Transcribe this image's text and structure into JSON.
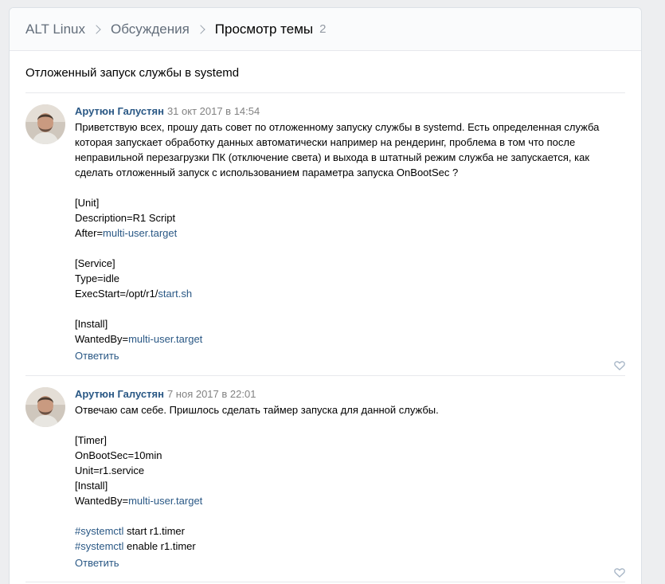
{
  "breadcrumb": {
    "community": "ALT Linux",
    "section": "Обсуждения",
    "current": "Просмотр темы",
    "count": "2"
  },
  "topic": {
    "title": "Отложенный запуск службы в systemd"
  },
  "posts": [
    {
      "author": "Арутюн Галустян",
      "date": "31 окт 2017 в 14:54",
      "reply_label": "Ответить",
      "lines": [
        [
          {
            "t": "Приветствую всех, прошу дать совет по отложенному запуску службы в systemd. Есть определенная служба"
          }
        ],
        [
          {
            "t": "которая запускает обработку данных автоматически например на рендеринг, проблема в том что после"
          }
        ],
        [
          {
            "t": "неправильной перезагрузки ПК (отключение света) и выхода в штатный режим служба не запускается, как"
          }
        ],
        [
          {
            "t": "сделать отложенный запуск с использованием параметра запуска OnBootSec ?"
          }
        ],
        [
          {
            "t": ""
          }
        ],
        [
          {
            "t": "[Unit]"
          }
        ],
        [
          {
            "t": "Description=R1 Script"
          }
        ],
        [
          {
            "t": "After="
          },
          {
            "t": "multi-user.target",
            "link": true
          }
        ],
        [
          {
            "t": ""
          }
        ],
        [
          {
            "t": "[Service]"
          }
        ],
        [
          {
            "t": "Type=idle"
          }
        ],
        [
          {
            "t": "ExecStart=/opt/r1/"
          },
          {
            "t": "start.sh",
            "link": true
          }
        ],
        [
          {
            "t": ""
          }
        ],
        [
          {
            "t": "[Install]"
          }
        ],
        [
          {
            "t": "WantedBy="
          },
          {
            "t": "multi-user.target",
            "link": true
          }
        ]
      ]
    },
    {
      "author": "Арутюн Галустян",
      "date": "7 ноя 2017 в 22:01",
      "reply_label": "Ответить",
      "lines": [
        [
          {
            "t": "Отвечаю сам себе. Пришлось сделать таймер запуска для данной службы."
          }
        ],
        [
          {
            "t": ""
          }
        ],
        [
          {
            "t": "[Timer]"
          }
        ],
        [
          {
            "t": "OnBootSec=10min"
          }
        ],
        [
          {
            "t": "Unit=r1.service"
          }
        ],
        [
          {
            "t": "[Install]"
          }
        ],
        [
          {
            "t": "WantedBy="
          },
          {
            "t": "multi-user.target",
            "link": true
          }
        ],
        [
          {
            "t": ""
          }
        ],
        [
          {
            "t": "#systemctl",
            "link": true
          },
          {
            "t": " start r1.timer"
          }
        ],
        [
          {
            "t": "#systemctl",
            "link": true
          },
          {
            "t": " enable r1.timer"
          }
        ]
      ]
    }
  ],
  "icons": {
    "like": "heart-icon",
    "separator": "chevron-right-icon",
    "avatar": "user-avatar"
  },
  "colors": {
    "link": "#2a5885",
    "meta": "#828282",
    "background": "#edeef0"
  }
}
